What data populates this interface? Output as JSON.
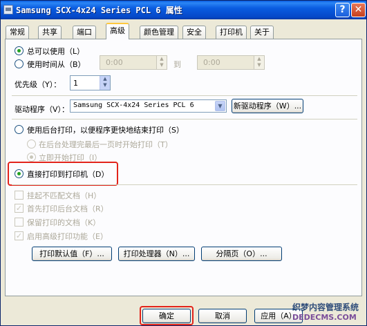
{
  "window": {
    "title": "Samsung SCX-4x24 Series PCL 6 属性",
    "help_label": "?",
    "close_label": "✕"
  },
  "tabs": [
    {
      "label": "常规",
      "active": false
    },
    {
      "label": "共享",
      "active": false
    },
    {
      "label": "端口",
      "active": false
    },
    {
      "label": "高级",
      "active": true
    },
    {
      "label": "颜色管理",
      "active": false
    },
    {
      "label": "安全",
      "active": false
    },
    {
      "label": "打印机",
      "active": false
    },
    {
      "label": "关于",
      "active": false
    }
  ],
  "availability": {
    "always_label": "总可以使用（L）",
    "from_label": "使用时间从（B）",
    "from_value": "0:00",
    "to_label": "到",
    "to_value": "0:00",
    "selected": "always"
  },
  "priority": {
    "label": "优先级（Y）：",
    "value": "1"
  },
  "driver": {
    "label": "驱动程序（V）：",
    "value": "Samsung SCX-4x24 Series PCL 6",
    "new_driver_label": "新驱动程序（W）..."
  },
  "spool": {
    "spool_label": "使用后台打印，以便程序更快地结束打印（S）",
    "after_last_page_label": "在后台处理完最后一页时开始打印（T）",
    "immediately_label": "立即开始打印（I）",
    "direct_label": "直接打印到打印机（D）",
    "selected": "direct"
  },
  "options": [
    {
      "label": "挂起不匹配文档（H）",
      "checked": false
    },
    {
      "label": "首先打印后台文档（R）",
      "checked": true
    },
    {
      "label": "保留打印的文档（K）",
      "checked": false
    },
    {
      "label": "启用高级打印功能（E）",
      "checked": true
    }
  ],
  "buttons": {
    "defaults": "打印默认值（F）...",
    "processor": "打印处理器（N）...",
    "separator": "分隔页（O）...",
    "ok": "确定",
    "cancel": "取消",
    "apply": "应用（A）"
  },
  "watermark": {
    "line1": "织梦内容管理系统",
    "line2": "DEDECMS.COM"
  },
  "colors": {
    "highlight": "#e2231a",
    "titlebar": "#0a5ce0"
  }
}
